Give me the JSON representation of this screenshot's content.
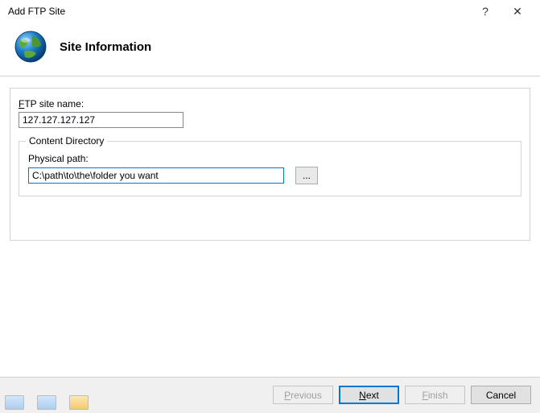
{
  "window": {
    "title": "Add FTP Site",
    "help": "?",
    "close": "✕"
  },
  "header": {
    "title": "Site Information"
  },
  "form": {
    "site_name_label_pre": "",
    "site_name_accel": "F",
    "site_name_label_post": "TP site name:",
    "site_name_value": "127.127.127.127",
    "content_dir_legend": "Content Directory",
    "physical_path_label": "Physical path:",
    "physical_path_value": "C:\\path\\to\\the\\folder you want",
    "browse_label": "..."
  },
  "footer": {
    "previous_pre": "",
    "previous_accel": "P",
    "previous_post": "revious",
    "next_pre": "",
    "next_accel": "N",
    "next_post": "ext",
    "finish_pre": "",
    "finish_accel": "F",
    "finish_post": "inish",
    "cancel": "Cancel"
  }
}
